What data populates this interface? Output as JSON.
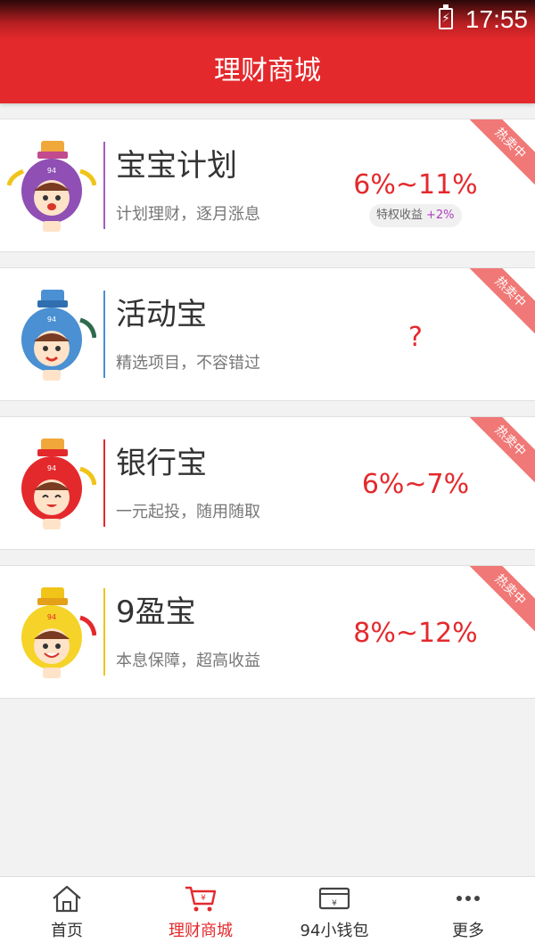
{
  "status": {
    "time": "17:55"
  },
  "header": {
    "title": "理财商城"
  },
  "products": [
    {
      "name": "宝宝计划",
      "desc": "计划理财，逐月涨息",
      "rate": "6%~11%",
      "badge": "热卖中",
      "privilege_label": "特权收益",
      "privilege_value": "+2%",
      "mascot": "purple-mascot-icon",
      "color": "#a65bc4"
    },
    {
      "name": "活动宝",
      "desc": "精选项目，不容错过",
      "rate": "?",
      "badge": "热卖中",
      "mascot": "blue-mascot-icon",
      "color": "#4a90d2"
    },
    {
      "name": "银行宝",
      "desc": "一元起投，随用随取",
      "rate": "6%~7%",
      "badge": "热卖中",
      "mascot": "red-mascot-icon",
      "color": "#e4292c"
    },
    {
      "name": "9盈宝",
      "desc": "本息保障，超高收益",
      "rate": "8%~12%",
      "badge": "热卖中",
      "mascot": "yellow-mascot-icon",
      "color": "#f0c419"
    }
  ],
  "tabs": [
    {
      "label": "首页",
      "icon": "home-icon"
    },
    {
      "label": "理财商城",
      "icon": "cart-icon",
      "active": true
    },
    {
      "label": "94小钱包",
      "icon": "wallet-icon"
    },
    {
      "label": "更多",
      "icon": "more-icon"
    }
  ],
  "colors": {
    "accent": "#e4292c",
    "ribbon": "#f07876"
  }
}
